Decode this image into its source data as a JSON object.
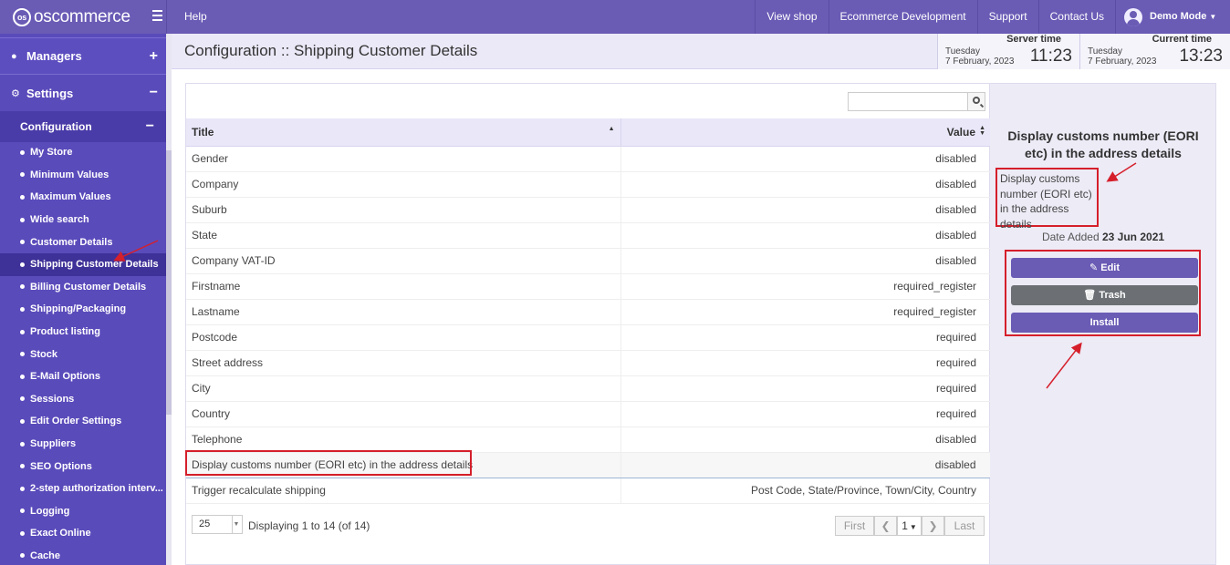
{
  "topbar": {
    "brand": "oscommerce",
    "help": "Help",
    "links": [
      "View shop",
      "Ecommerce Development",
      "Support",
      "Contact Us"
    ],
    "user": "Demo Mode"
  },
  "sidebar": {
    "managers": "Managers",
    "settings": "Settings",
    "configuration": "Configuration",
    "items": [
      "My Store",
      "Minimum Values",
      "Maximum Values",
      "Wide search",
      "Customer Details",
      "Shipping Customer Details",
      "Billing Customer Details",
      "Shipping/Packaging",
      "Product listing",
      "Stock",
      "E-Mail Options",
      "Sessions",
      "Edit Order Settings",
      "Suppliers",
      "SEO Options",
      "2-step authorization interv...",
      "Logging",
      "Exact Online",
      "Cache"
    ]
  },
  "header": {
    "title": "Configuration :: Shipping Customer Details",
    "server_label": "Server time",
    "server_day": "Tuesday",
    "server_date": "7 February, 2023",
    "server_time": "11:23",
    "current_label": "Current time",
    "current_day": "Tuesday",
    "current_date": "7 February, 2023",
    "current_time": "13:23"
  },
  "table": {
    "search_placeholder": "",
    "columns": [
      "Title",
      "Value"
    ],
    "rows": [
      [
        "Gender",
        "disabled"
      ],
      [
        "Company",
        "disabled"
      ],
      [
        "Suburb",
        "disabled"
      ],
      [
        "State",
        "disabled"
      ],
      [
        "Company VAT-ID",
        "disabled"
      ],
      [
        "Firstname",
        "required_register"
      ],
      [
        "Lastname",
        "required_register"
      ],
      [
        "Postcode",
        "required"
      ],
      [
        "Street address",
        "required"
      ],
      [
        "City",
        "required"
      ],
      [
        "Country",
        "required"
      ],
      [
        "Telephone",
        "disabled"
      ],
      [
        "Display customs number (EORI etc) in the address details",
        "disabled"
      ],
      [
        "Trigger recalculate shipping",
        "Post Code, State/Province, Town/City, Country"
      ]
    ]
  },
  "pager": {
    "per_page": "25",
    "display": "Displaying 1 to 14 (of 14)",
    "first": "First",
    "page": "1",
    "last": "Last"
  },
  "detail": {
    "title": "Display customs number (EORI etc) in the address details",
    "description": "Display customs number (EORI etc) in the address details",
    "date_label": "Date Added",
    "date_value": "23 Jun 2021",
    "edit": "Edit",
    "trash": "Trash",
    "install": "Install"
  },
  "colors": {
    "brand": "#6a5bb5",
    "sidebar": "#5a4bbb",
    "annotation": "#d51f2b"
  }
}
